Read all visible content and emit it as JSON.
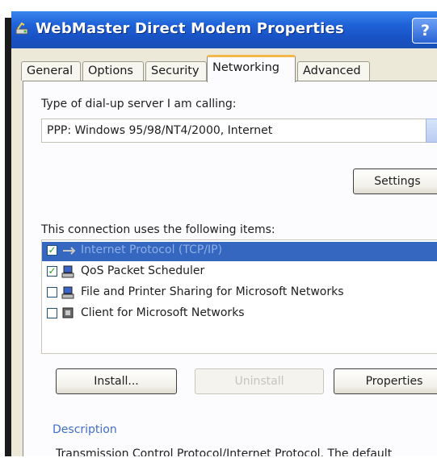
{
  "window": {
    "title": "WebMaster Direct Modem Properties",
    "help_label": "?"
  },
  "tabs": [
    {
      "label": "General"
    },
    {
      "label": "Options"
    },
    {
      "label": "Security"
    },
    {
      "label": "Networking"
    },
    {
      "label": "Advanced"
    }
  ],
  "networking": {
    "server_type_label": "Type of dial-up server I am calling:",
    "server_type_value": "PPP: Windows 95/98/NT4/2000, Internet",
    "settings_button": "Settings",
    "items_label": "This connection uses the following items:",
    "items": [
      {
        "label": "Internet Protocol (TCP/IP)",
        "checked": true,
        "selected": true,
        "icon": "protocol-icon"
      },
      {
        "label": "QoS Packet Scheduler",
        "checked": true,
        "selected": false,
        "icon": "network-service-icon"
      },
      {
        "label": "File and Printer Sharing for Microsoft Networks",
        "checked": false,
        "selected": false,
        "icon": "network-service-icon"
      },
      {
        "label": "Client for Microsoft Networks",
        "checked": false,
        "selected": false,
        "icon": "network-client-icon"
      }
    ],
    "install_button": "Install...",
    "uninstall_button": "Uninstall",
    "properties_button": "Properties",
    "description_title": "Description",
    "description_text": "Transmission Control Protocol/Internet Protocol. The default"
  },
  "colors": {
    "titlebar": "#1f5fd6",
    "selection": "#3566c0",
    "active_tab_accent": "#f4b84a",
    "groupbox_title": "#3f6fc9"
  }
}
